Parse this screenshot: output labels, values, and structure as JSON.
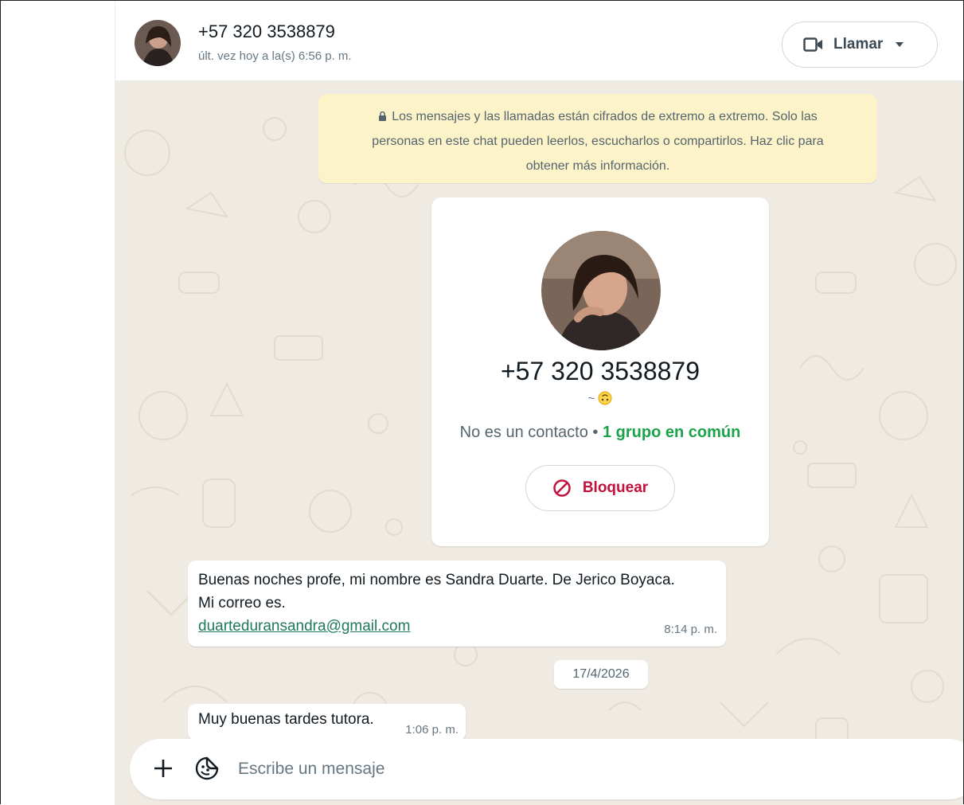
{
  "header": {
    "contact_name": "+57 320 3538879",
    "last_seen": "últ. vez hoy a la(s) 6:56 p. m.",
    "call_button_label": "Llamar",
    "call_icon": "video-camera-icon"
  },
  "encryption_notice": {
    "line1": "Los mensajes y las llamadas están cifrados de extremo a extremo. Solo las",
    "line2": "personas en este chat pueden leerlos, escucharlos o compartirlos. Haz clic para",
    "line3": "obtener más información."
  },
  "contact_card": {
    "phone": "+57 320 3538879",
    "about": "~",
    "not_contact": "No es un contacto",
    "separator": "•",
    "groups_in_common": "1 grupo en común",
    "block_label": "Bloquear"
  },
  "messages": [
    {
      "line1": "Buenas noches profe, mi nombre es Sandra Duarte. De Jerico Boyaca.",
      "line2": "Mi correo es.",
      "link": "duarteduransandra@gmail.com",
      "time": "8:14 p. m."
    },
    {
      "text": "Muy buenas tardes tutora.",
      "time": "1:06 p. m."
    }
  ],
  "date_divider": "17/4/2026",
  "composer": {
    "placeholder": "Escribe un mensaje"
  },
  "colors": {
    "wallpaper": "#efeae2",
    "notice_bg": "#fdf3c9",
    "accent_green": "#1aa34a",
    "block_red": "#c0123c"
  }
}
